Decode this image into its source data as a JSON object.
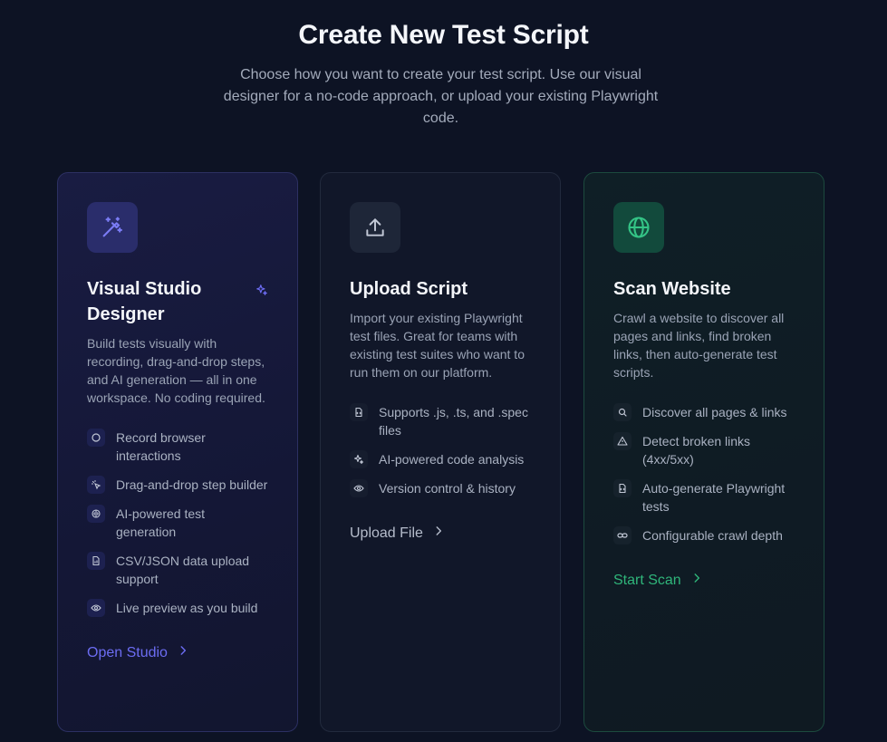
{
  "header": {
    "title": "Create New Test Script",
    "subtitle": "Choose how you want to create your test script. Use our visual designer for a no-code approach, or upload your existing Playwright code."
  },
  "cards": [
    {
      "title": "Visual Studio Designer",
      "description": "Build tests visually with recording, drag-and-drop steps, and AI generation — all in one workspace. No coding required.",
      "icon": "magic-wand-icon",
      "badge_icon": "sparkles-icon",
      "features": [
        {
          "icon": "circle-icon",
          "label": "Record browser interactions"
        },
        {
          "icon": "pointer-click-icon",
          "label": "Drag-and-drop step builder"
        },
        {
          "icon": "brain-icon",
          "label": "AI-powered test generation"
        },
        {
          "icon": "file-icon",
          "label": "CSV/JSON data upload support"
        },
        {
          "icon": "eye-icon",
          "label": "Live preview as you build"
        }
      ],
      "cta": "Open Studio",
      "accent": "#6c6cf2"
    },
    {
      "title": "Upload Script",
      "description": "Import your existing Playwright test files. Great for teams with existing test suites who want to run them on our platform.",
      "icon": "upload-icon",
      "features": [
        {
          "icon": "file-code-icon",
          "label": "Supports .js, .ts, and .spec files"
        },
        {
          "icon": "sparkles-icon",
          "label": "AI-powered code analysis"
        },
        {
          "icon": "eye-icon",
          "label": "Version control & history"
        }
      ],
      "cta": "Upload File",
      "accent": "#b5bccb"
    },
    {
      "title": "Scan Website",
      "description": "Crawl a website to discover all pages and links, find broken links, then auto-generate test scripts.",
      "icon": "globe-icon",
      "features": [
        {
          "icon": "search-icon",
          "label": "Discover all pages & links"
        },
        {
          "icon": "warning-icon",
          "label": "Detect broken links (4xx/5xx)"
        },
        {
          "icon": "file-icon",
          "label": "Auto-generate Playwright tests"
        },
        {
          "icon": "link-icon",
          "label": "Configurable crawl depth"
        }
      ],
      "cta": "Start Scan",
      "accent": "#2fb57a"
    }
  ]
}
